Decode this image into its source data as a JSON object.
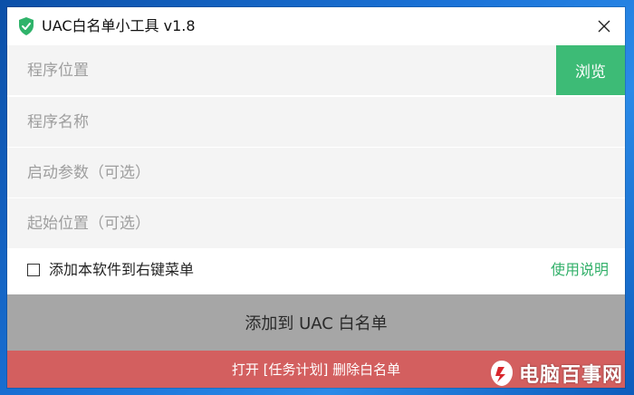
{
  "window": {
    "title": "UAC白名单小工具 v1.8",
    "close_glyph": "✕"
  },
  "fields": {
    "program_location_placeholder": "程序位置",
    "program_name_placeholder": "程序名称",
    "start_params_placeholder": "启动参数（可选）",
    "start_location_placeholder": "起始位置（可选）"
  },
  "browse_label": "浏览",
  "context_menu": {
    "label": "添加本软件到右键菜单",
    "checked": false
  },
  "help_label": "使用说明",
  "add_button_label": "添加到 UAC 白名单",
  "delete_button_label": "打开 [任务计划] 删除白名单",
  "watermark": {
    "text": "电脑百事网"
  },
  "colors": {
    "accent_green": "#3dbb76",
    "add_gray": "#a6a6a6",
    "delete_red": "#d35f5f",
    "field_bg": "#f4f4f4"
  },
  "icons": {
    "app": "shield-check-icon",
    "close": "close-icon",
    "checkbox": "checkbox-icon",
    "watermark_logo": "pc841-logo-icon"
  }
}
